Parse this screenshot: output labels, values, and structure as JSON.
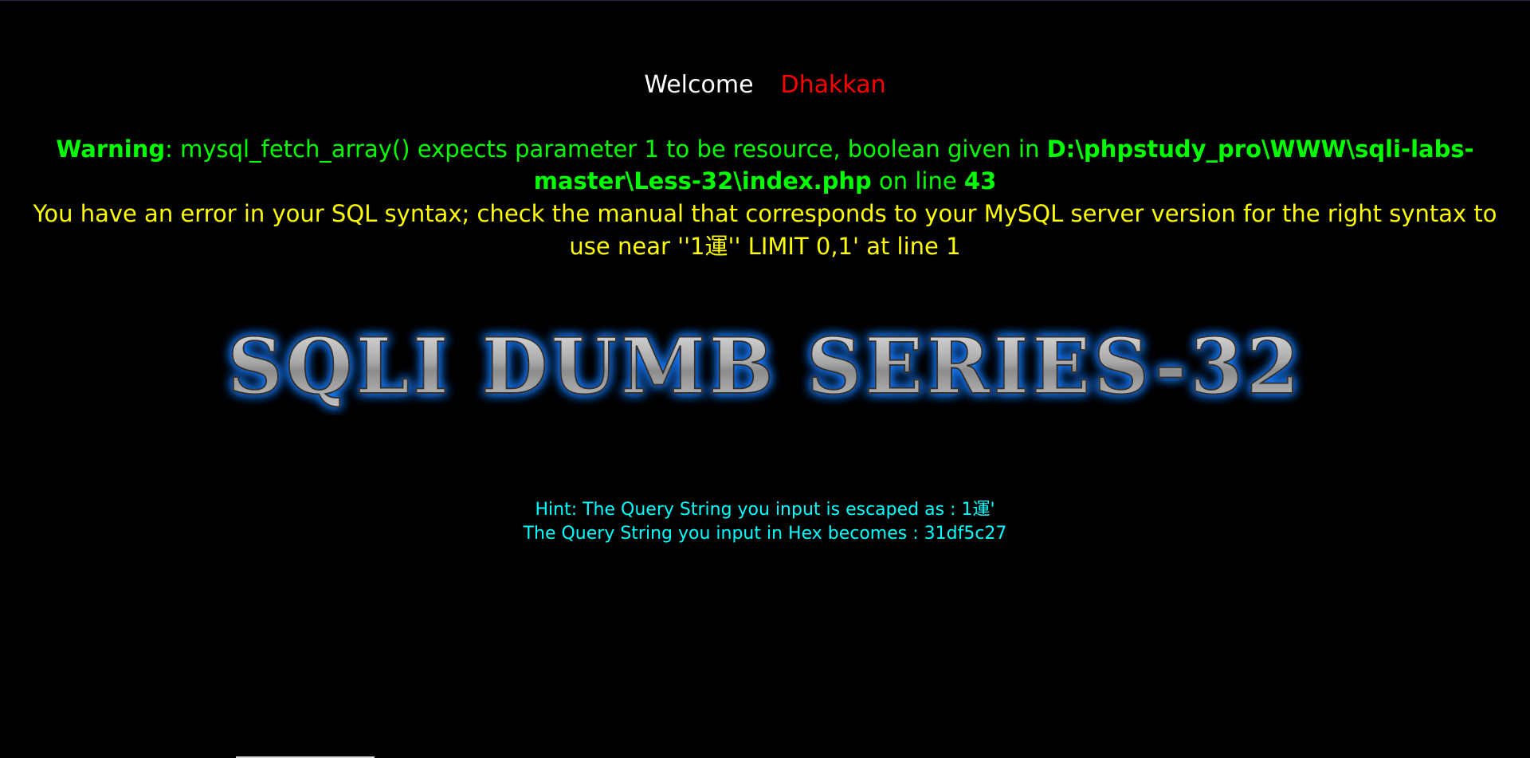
{
  "welcome": {
    "label": "Welcome",
    "name": "Dhakkan"
  },
  "warning": {
    "label": "Warning",
    "message": ": mysql_fetch_array() expects parameter 1 to be resource, boolean given in ",
    "path": "D:\\phpstudy_pro\\WWW\\sqli-labs-master\\Less-32\\index.php",
    "on_line_text": " on line ",
    "line": "43"
  },
  "sql_error": {
    "text": "You have an error in your SQL syntax; check the manual that corresponds to your MySQL server version for the right syntax to use near ''1運'' LIMIT 0,1' at line 1"
  },
  "banner": {
    "title": "SQLI DUMB SERIES-32",
    "glow_color": "#1a7cff"
  },
  "hint": {
    "escaped_line": "Hint: The Query String you input is escaped as : 1運'",
    "hex_line": "The Query String you input in Hex becomes : 31df5c27"
  },
  "colors": {
    "background": "#000000",
    "warning": "#00ff00",
    "error": "#ffff00",
    "hint": "#00ffff",
    "name": "#ff0000"
  }
}
